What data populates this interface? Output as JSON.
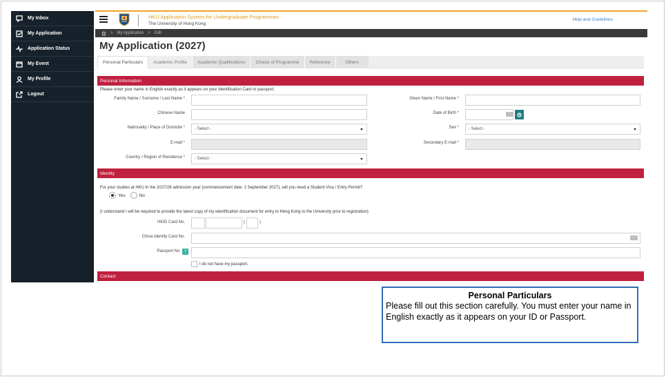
{
  "sidebar": {
    "items": [
      {
        "label": "My Inbox",
        "icon": "chat-icon"
      },
      {
        "label": "My Application",
        "icon": "checkbox-icon"
      },
      {
        "label": "Application Status",
        "icon": "pulse-icon"
      },
      {
        "label": "My Event",
        "icon": "calendar-icon"
      },
      {
        "label": "My Profile",
        "icon": "user-icon"
      },
      {
        "label": "Logout",
        "icon": "logout-icon"
      }
    ]
  },
  "header": {
    "system_title": "HKU Application System for Undergraduate Programmes",
    "university": "The University of Hong Kong",
    "help_link": "Help and Guidelines"
  },
  "breadcrumb": {
    "items": [
      "My Application",
      "Edit"
    ],
    "separator": ">"
  },
  "page": {
    "title": "My Application (2027)"
  },
  "tabs": [
    {
      "label": "Personal Particulars"
    },
    {
      "label": "Academic Profile"
    },
    {
      "label": "Academic Qualifications"
    },
    {
      "label": "Choice of Programme"
    },
    {
      "label": "Reference"
    },
    {
      "label": "Others"
    }
  ],
  "personal": {
    "section_title": "Personal Information",
    "note": "Please enter your name in English exactly as it appears on your Identification Card or passport.",
    "family_name_label": "Family Name / Surname / Last Name",
    "given_name_label": "Given Name / First Name",
    "chinese_name_label": "Chinese Name",
    "dob_label": "Date of Birth",
    "nationality_label": "Nationality / Place of Domicile",
    "nationality_value": "- Select -",
    "sex_label": "Sex",
    "sex_value": "- Select -",
    "email_label": "E-mail",
    "secondary_email_label": "Secondary E-mail",
    "residence_label": "Country / Region of Residence",
    "residence_value": "- Select -",
    "required_mark": "*"
  },
  "identity": {
    "section_title": "Identity",
    "visa_question": "For your studies at HKU in the 2027/28 admission year (commencement date: 1 September 2027), will you need a Student Visa / Entry Permit?",
    "yes_label": "Yes",
    "no_label": "No",
    "selected": "Yes",
    "id_note": "(I understand I will be required to provide the latest copy of my identification document for entry to Hong Kong to the University prior to registration)",
    "hkid_label": "HKID Card No.",
    "paren_open": "(",
    "paren_close": ")",
    "china_id_label": "China Identity Card No.",
    "passport_label": "Passport No.",
    "info_symbol": "?",
    "no_passport_label": "I do not have my passport."
  },
  "contact": {
    "section_title": "Contact"
  },
  "callout": {
    "title": "Personal Particulars",
    "body": "Please fill out this section carefully. You must enter your name in English exactly as it appears on your ID or Passport."
  },
  "colors": {
    "sidebar_bg": "#17212b",
    "section_red": "#c0203f",
    "accent_orange": "#f0a22a",
    "teal": "#1f7c80",
    "callout_border": "#2f6db8"
  }
}
